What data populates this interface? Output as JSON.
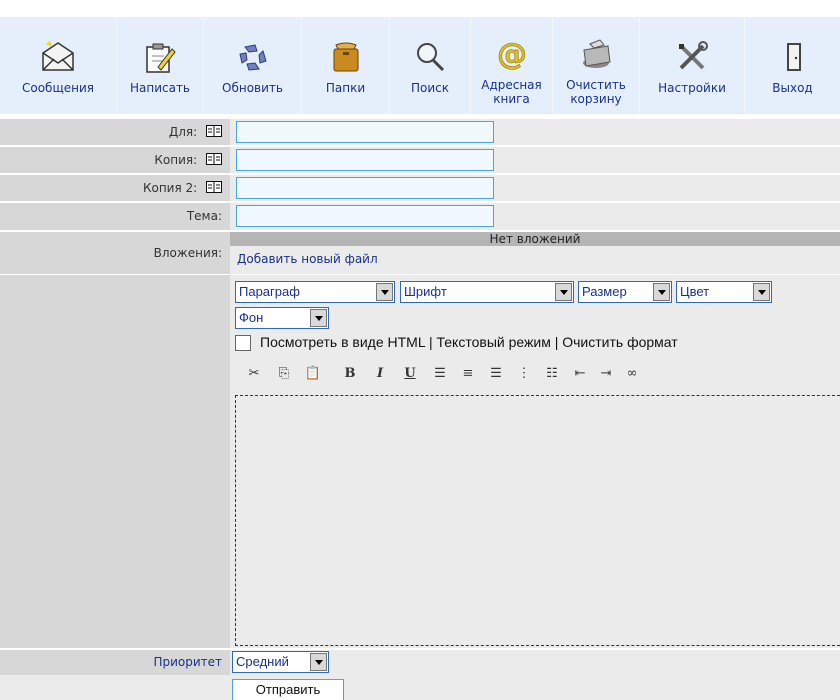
{
  "toolbar": {
    "items": [
      {
        "label": "Сообщения",
        "icon": "envelope-icon"
      },
      {
        "label": "Написать",
        "icon": "compose-icon"
      },
      {
        "label": "Обновить",
        "icon": "refresh-icon"
      },
      {
        "label": "Папки",
        "icon": "folders-icon"
      },
      {
        "label": "Поиск",
        "icon": "search-icon"
      },
      {
        "label": "Адресная\nкнига",
        "icon": "at-icon"
      },
      {
        "label": "Очистить\nкорзину",
        "icon": "trash-icon"
      },
      {
        "label": "Настройки",
        "icon": "tools-icon"
      },
      {
        "label": "Выход",
        "icon": "door-icon"
      }
    ]
  },
  "form": {
    "to_label": "Для:",
    "cc_label": "Копия:",
    "bcc_label": "Копия 2:",
    "subject_label": "Тема:",
    "attachments_label": "Вложения:",
    "no_attachments": "Нет вложений",
    "add_file": "Добавить новый файл",
    "priority_label": "Приоритет",
    "priority_value": "Средний",
    "send_label": "Отправить"
  },
  "editor": {
    "paragraph": "Параграф",
    "font": "Шрифт",
    "size": "Размер",
    "color": "Цвет",
    "background": "Фон",
    "html_toggle": "Посмотреть в виде HTML | Текстовый режим | Очистить формат"
  },
  "colors": {
    "accent": "#17328c",
    "toolbar_bg": "#e5effc",
    "label_bg": "#d7d7d7",
    "value_bg": "#ebebeb",
    "input_border": "#49a6e0"
  }
}
